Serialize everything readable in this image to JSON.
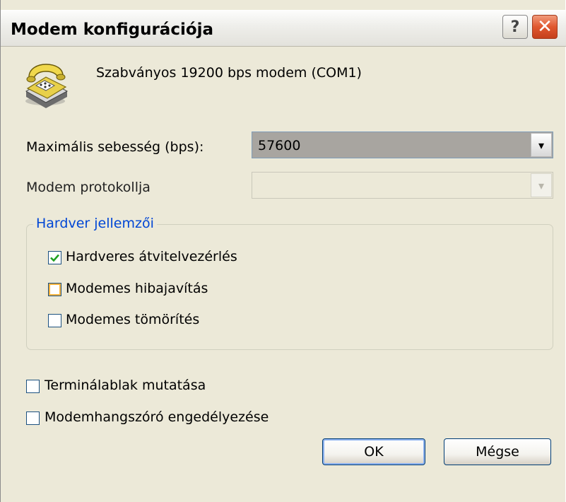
{
  "window": {
    "title": "Modem konfigurációja",
    "help_label": "?",
    "close_label": "✕"
  },
  "modem": {
    "name": "Szabványos 19200 bps modem (COM1)",
    "icon": "telephone-modem-icon"
  },
  "speed": {
    "label": "Maximális sebesség (bps):",
    "value": "57600",
    "arrow": "▾"
  },
  "protocol": {
    "label": "Modem protokollja",
    "value": "",
    "arrow": "▾",
    "enabled": false
  },
  "hardware": {
    "legend": "Hardver jellemzői",
    "options": [
      {
        "label": "Hardveres átvitelvezérlés",
        "checked": true
      },
      {
        "label": "Modemes hibajavítás",
        "checked": false
      },
      {
        "label": "Modemes tömörítés",
        "checked": false
      }
    ]
  },
  "options": [
    {
      "label": "Terminálablak mutatása",
      "checked": false
    },
    {
      "label": "Modemhangszóró engedélyezése",
      "checked": false
    }
  ],
  "buttons": {
    "ok": "OK",
    "cancel": "Mégse"
  },
  "colors": {
    "dialog_bg": "#ece9d8",
    "legend_blue": "#0046d5",
    "check_green": "#21a121",
    "close_red": "#e0582f"
  }
}
